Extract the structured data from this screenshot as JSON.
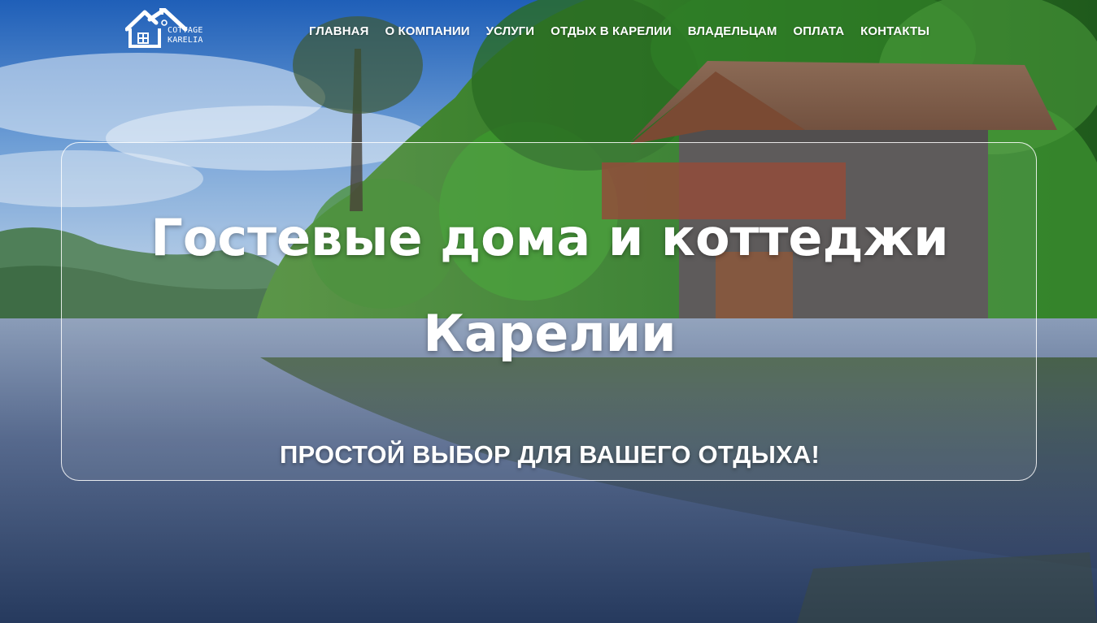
{
  "logo": {
    "line1": "COTTAGE",
    "line2": "KARELIA",
    "icon": "house-roof-icon"
  },
  "nav": {
    "items": [
      {
        "label": "ГЛАВНАЯ"
      },
      {
        "label": "О КОМПАНИИ"
      },
      {
        "label": "УСЛУГИ"
      },
      {
        "label": "ОТДЫХ В КАРЕЛИИ"
      },
      {
        "label": "ВЛАДЕЛЬЦАМ"
      },
      {
        "label": "ОПЛАТА"
      },
      {
        "label": "КОНТАКТЫ"
      }
    ]
  },
  "hero": {
    "title": "Гостевые дома и коттеджи Карелии",
    "subtitle": "ПРОСТОЙ ВЫБОР ДЛЯ ВАШЕГО ОТДЫХА!"
  },
  "colors": {
    "text": "#ffffff",
    "sky": "#3b78c4",
    "forest": "#2f7a2f",
    "lake": "#5b6f93"
  }
}
